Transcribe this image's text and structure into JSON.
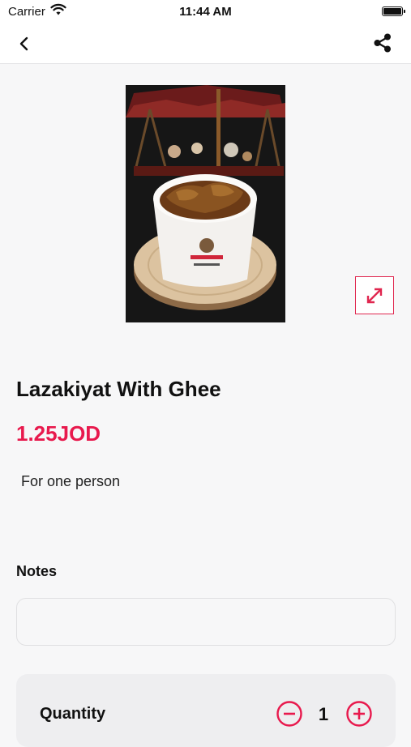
{
  "status_bar": {
    "carrier": "Carrier",
    "time": "11:44 AM"
  },
  "nav": {
    "back_icon": "chevron-left-icon",
    "share_icon": "share-icon"
  },
  "product": {
    "name": "Lazakiyat With Ghee",
    "price": "1.25JOD",
    "description": "For one person",
    "image_icon": "expand-icon"
  },
  "notes": {
    "label": "Notes",
    "value": "",
    "placeholder": ""
  },
  "quantity": {
    "label": "Quantity",
    "value": "1"
  },
  "colors": {
    "accent": "#e8194d",
    "background": "#f7f7f8"
  }
}
